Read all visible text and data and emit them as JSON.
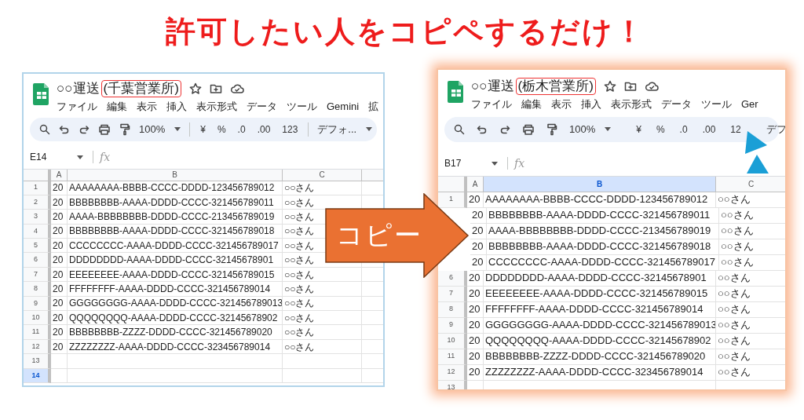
{
  "headline": "許可したい人をコピペするだけ！",
  "arrow": {
    "label": "コピー"
  },
  "sheets": [
    {
      "title": "○○運送",
      "title_highlight": "(千葉営業所)",
      "menu": [
        "ファイル",
        "編集",
        "表示",
        "挿入",
        "表示形式",
        "データ",
        "ツール",
        "Gemini",
        "拡"
      ],
      "zoom": "100%",
      "format_buttons": [
        "¥",
        "%",
        ".0",
        ".00",
        "123"
      ],
      "font": "デフォ...",
      "name_box": "E14",
      "formula_label": "fx",
      "columns": [
        {
          "label": "A",
          "selected": false
        },
        {
          "label": "B",
          "selected": false
        },
        {
          "label": "C",
          "selected": false
        }
      ],
      "rows": [
        {
          "number": "1",
          "selected": false,
          "cells": [
            "20",
            "AAAAAAAA-BBBB-CCCC-DDDD-123456789012",
            "○○さん"
          ]
        },
        {
          "number": "2",
          "selected": false,
          "cells": [
            "20",
            "BBBBBBBB-AAAA-DDDD-CCCC-321456789011",
            "○○さん"
          ]
        },
        {
          "number": "3",
          "selected": false,
          "cells": [
            "20",
            "AAAA-BBBBBBBB-DDDD-CCCC-213456789019",
            "○○さん"
          ]
        },
        {
          "number": "4",
          "selected": false,
          "cells": [
            "20",
            "BBBBBBBB-AAAA-DDDD-CCCC-321456789018",
            "○○さん"
          ]
        },
        {
          "number": "5",
          "selected": false,
          "cells": [
            "20",
            "CCCCCCCC-AAAA-DDDD-CCCC-321456789017",
            "○○さん"
          ]
        },
        {
          "number": "6",
          "selected": false,
          "cells": [
            "20",
            "DDDDDDDD-AAAA-DDDD-CCCC-32145678901",
            "○○さん"
          ]
        },
        {
          "number": "7",
          "selected": false,
          "cells": [
            "20",
            "EEEEEEEE-AAAA-DDDD-CCCC-321456789015",
            "○○さん"
          ]
        },
        {
          "number": "8",
          "selected": false,
          "cells": [
            "20",
            "FFFFFFFF-AAAA-DDDD-CCCC-321456789014",
            "○○さん"
          ]
        },
        {
          "number": "9",
          "selected": false,
          "cells": [
            "20",
            "GGGGGGGG-AAAA-DDDD-CCCC-321456789013",
            "○○さん"
          ]
        },
        {
          "number": "10",
          "selected": false,
          "cells": [
            "20",
            "QQQQQQQQ-AAAA-DDDD-CCCC-32145678902",
            "○○さん"
          ]
        },
        {
          "number": "11",
          "selected": false,
          "cells": [
            "20",
            "BBBBBBBB-ZZZZ-DDDD-CCCC-321456789020",
            "○○さん"
          ]
        },
        {
          "number": "12",
          "selected": false,
          "cells": [
            "20",
            "ZZZZZZZZ-AAAA-DDDD-CCCC-323456789014",
            "○○さん"
          ]
        },
        {
          "number": "13",
          "selected": false,
          "cells": []
        },
        {
          "number": "14",
          "selected": true,
          "cells": []
        }
      ]
    },
    {
      "title": "○○運送",
      "title_highlight": "(栃木営業所)",
      "menu": [
        "ファイル",
        "編集",
        "表示",
        "挿入",
        "表示形式",
        "データ",
        "ツール",
        "Ger"
      ],
      "zoom": "100%",
      "format_buttons": [
        "¥",
        "%",
        ".0",
        ".00",
        "12"
      ],
      "font": "デフ",
      "name_box": "B17",
      "formula_label": "fx",
      "columns": [
        {
          "label": "A",
          "selected": false
        },
        {
          "label": "B",
          "selected": true
        },
        {
          "label": "C",
          "selected": false
        }
      ],
      "rows": [
        {
          "number": "1",
          "selected": false,
          "cells": [
            "20",
            "AAAAAAAA-BBBB-CCCC-DDDD-123456789012",
            "○○さん"
          ]
        },
        {
          "cells": [
            "20",
            "BBBBBBBB-AAAA-DDDD-CCCC-321456789011",
            "○○さん"
          ]
        },
        {
          "cells": [
            "20",
            "AAAA-BBBBBBBB-DDDD-CCCC-213456789019",
            "○○さん"
          ]
        },
        {
          "cells": [
            "20",
            "BBBBBBBB-AAAA-DDDD-CCCC-321456789018",
            "○○さん"
          ]
        },
        {
          "cells": [
            "20",
            "CCCCCCCC-AAAA-DDDD-CCCC-321456789017",
            "○○さん"
          ]
        },
        {
          "number": "6",
          "selected": false,
          "cells": [
            "20",
            "DDDDDDDD-AAAA-DDDD-CCCC-32145678901",
            "○○さん"
          ]
        },
        {
          "number": "7",
          "selected": false,
          "cells": [
            "20",
            "EEEEEEEE-AAAA-DDDD-CCCC-321456789015",
            "○○さん"
          ]
        },
        {
          "number": "8",
          "selected": false,
          "cells": [
            "20",
            "FFFFFFFF-AAAA-DDDD-CCCC-321456789014",
            "○○さん"
          ]
        },
        {
          "number": "9",
          "selected": false,
          "cells": [
            "20",
            "GGGGGGGG-AAAA-DDDD-CCCC-321456789013",
            "○○さん"
          ]
        },
        {
          "number": "10",
          "selected": false,
          "cells": [
            "20",
            "QQQQQQQQ-AAAA-DDDD-CCCC-32145678902",
            "○○さん"
          ]
        },
        {
          "number": "11",
          "selected": false,
          "cells": [
            "20",
            "BBBBBBBB-ZZZZ-DDDD-CCCC-321456789020",
            "○○さん"
          ]
        },
        {
          "number": "12",
          "selected": false,
          "cells": [
            "20",
            "ZZZZZZZZ-AAAA-DDDD-CCCC-323456789014",
            "○○さん"
          ]
        },
        {
          "number": "13",
          "selected": false,
          "cells": []
        }
      ]
    }
  ]
}
